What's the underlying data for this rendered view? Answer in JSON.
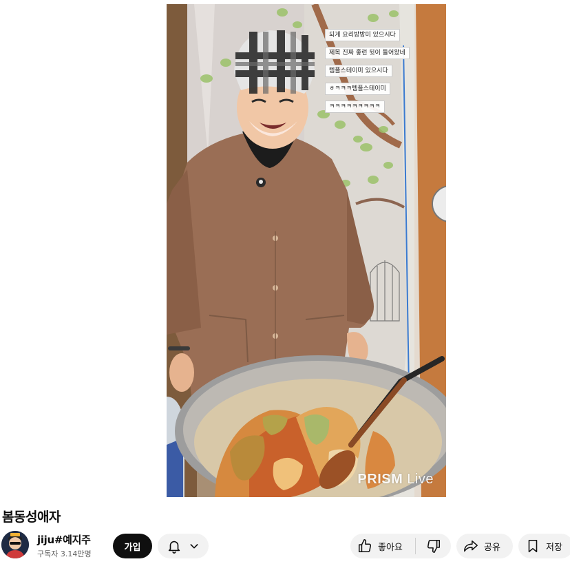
{
  "video": {
    "chat_overlay": [
      "되게 요리방방미 있으시다",
      "제목 진짜 좋런 뒷이 들어왔네",
      "템플스테이미 있으시다",
      "ㅎㅋㅋㅋ템플스테이미",
      "ㅋㅋㅋㅋㅋㅋㅋㅋㅋ"
    ],
    "watermark_bold": "PRISM",
    "watermark_light": " Live"
  },
  "title": "봄동성애자",
  "channel": {
    "name": "jiju#예지주",
    "subscribers": "구독자 3.14만명",
    "avatar_icon": "channel-avatar"
  },
  "actions": {
    "join_label": "가입",
    "like_label": "좋아요",
    "share_label": "공유",
    "save_label": "저장"
  },
  "icons": {
    "bell": "bell-icon",
    "chevron": "chevron-down-icon",
    "like": "thumb-up-icon",
    "dislike": "thumb-down-icon",
    "share": "share-arrow-icon",
    "save": "bookmark-icon"
  }
}
